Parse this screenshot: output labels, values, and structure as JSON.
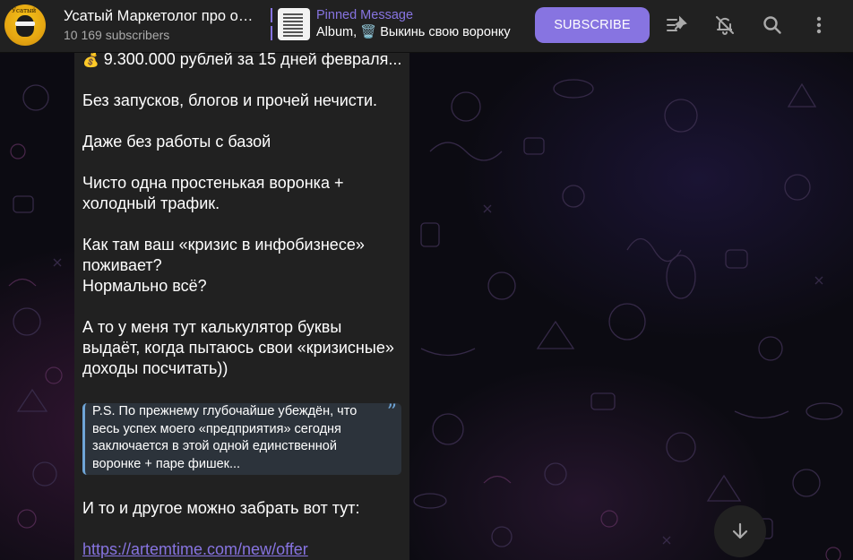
{
  "channel": {
    "title": "Усатый Маркетолог про обучение",
    "subscribers": "10 169 subscribers",
    "avatar_text": "Усатый"
  },
  "pinned": {
    "label": "Pinned Message",
    "album": "Album,",
    "emoji": "🗑️",
    "preview": "Выкинь свою воронку"
  },
  "header": {
    "subscribe_label": "SUBSCRIBE"
  },
  "icons": {
    "unpin": "unpin-icon",
    "mute": "bell-off-icon",
    "search": "search-icon",
    "more": "more-vertical-icon",
    "scroll": "arrow-down-icon"
  },
  "colors": {
    "accent": "#8774e1",
    "quote": "#6fa5d7",
    "header_bg": "#212121",
    "bubble_bg": "#212121"
  },
  "message": {
    "line1_emoji": "💰",
    "line1": "9.300.000 рублей за 15 дней февраля...",
    "p2": "Без запусков, блогов и прочей нечисти.",
    "p3": "Даже без работы с базой",
    "p4a": "Чисто одна простенькая воронка +",
    "p4b": "холодный трафик.",
    "p5a": "Как там ваш «кризис в инфобизнесе»",
    "p5b": "поживает?",
    "p5c": "Нормально всё?",
    "p6a": "А то у меня тут калькулятор буквы",
    "p6b": "выдаёт, когда пытаюсь свои «кризисные»",
    "p6c": "доходы посчитать))",
    "quote_l1": "P.S. По прежнему глубочайше убеждён, что",
    "quote_l2": "весь успех моего «предприятия» сегодня",
    "quote_l3": "заключается в этой одной единственной",
    "quote_l4": "воронке + паре фишек...",
    "p8": "И то и другое можно забрать вот тут:",
    "link": "https://artemtime.com/new/offer"
  }
}
